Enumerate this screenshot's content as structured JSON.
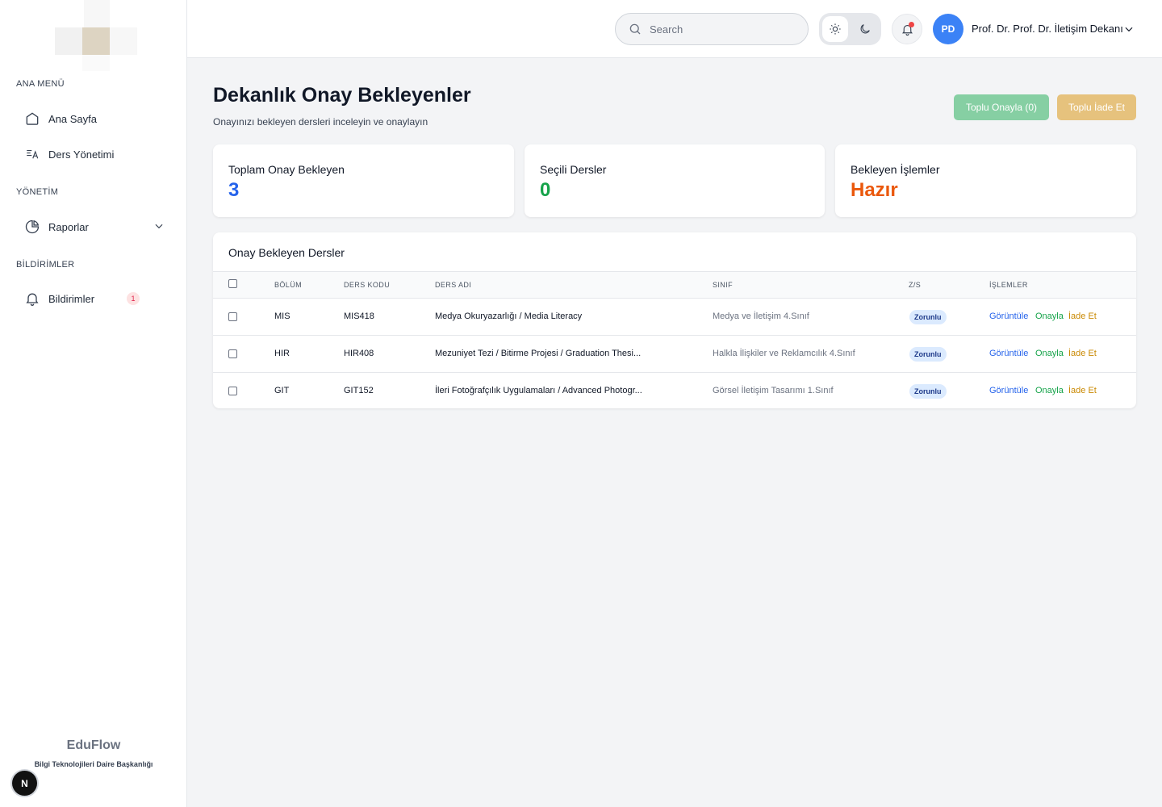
{
  "sidebar": {
    "sections": {
      "main": "ANA MENÜ",
      "management": "YÖNETİM",
      "notifications": "BİLDİRİMLER"
    },
    "items": {
      "home": "Ana Sayfa",
      "courses": "Ders Yönetimi",
      "reports": "Raporlar",
      "notifications": "Bildirimler",
      "notifications_count": "1"
    },
    "brand": "EduFlow",
    "brand_sub": "Bilgi Teknolojileri Daire Başkanlığı",
    "n_badge": "N"
  },
  "header": {
    "search_placeholder": "Search",
    "avatar_initials": "PD",
    "user_name": "Prof. Dr. Prof. Dr. İletişim Dekanı"
  },
  "page": {
    "title": "Dekanlık Onay Bekleyenler",
    "subtitle": "Onayınızı bekleyen dersleri inceleyin ve onaylayın",
    "bulk_approve": "Toplu Onayla (0)",
    "bulk_return": "Toplu İade Et"
  },
  "stats": {
    "total_label": "Toplam Onay Bekleyen",
    "total_value": "3",
    "selected_label": "Seçili Dersler",
    "selected_value": "0",
    "pending_label": "Bekleyen İşlemler",
    "pending_value": "Hazır"
  },
  "table": {
    "title": "Onay Bekleyen Dersler",
    "headers": {
      "dept": "BÖLÜM",
      "code": "DERS KODU",
      "name": "DERS ADI",
      "class": "SINIF",
      "zs": "Z/S",
      "actions": "İŞLEMLER"
    },
    "action_labels": {
      "view": "Görüntüle",
      "approve": "Onayla",
      "return": "İade Et"
    },
    "rows": [
      {
        "dept": "MIS",
        "code": "MIS418",
        "name": "Medya Okuryazarlığı / Media Literacy",
        "class": "Medya ve İletişim 4.Sınıf",
        "zs": "Zorunlu"
      },
      {
        "dept": "HIR",
        "code": "HIR408",
        "name": "Mezuniyet Tezi / Bitirme Projesi / Graduation Thesi...",
        "class": "Halkla İlişkiler ve Reklamcılık 4.Sınıf",
        "zs": "Zorunlu"
      },
      {
        "dept": "GIT",
        "code": "GIT152",
        "name": "İleri Fotoğrafçılık Uygulamaları / Advanced Photogr...",
        "class": "Görsel İletişim Tasarımı 1.Sınıf",
        "zs": "Zorunlu"
      }
    ]
  },
  "colors": {
    "primary_blue": "#2563eb",
    "success_green": "#16a34a",
    "warning_orange": "#ea580c",
    "avatar_blue": "#3b82f6"
  }
}
